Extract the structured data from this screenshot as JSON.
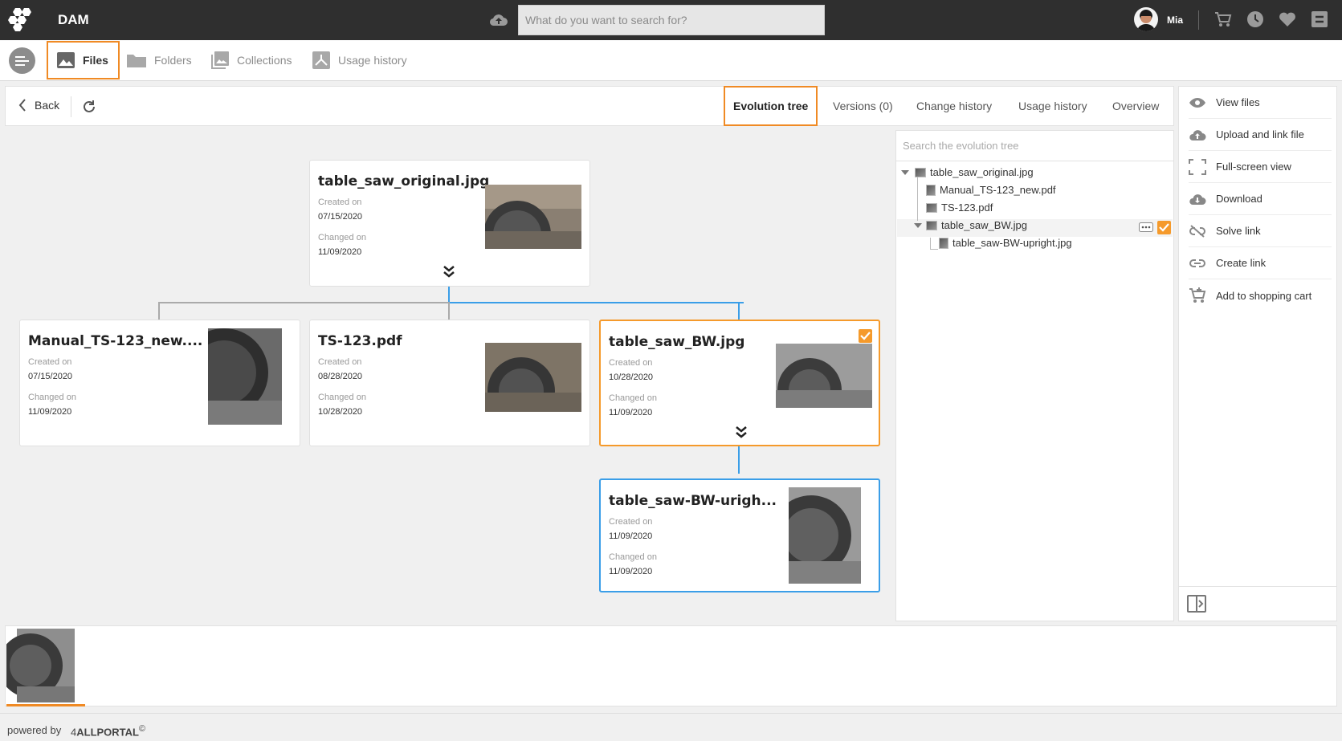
{
  "header": {
    "app_title": "DAM",
    "search_placeholder": "What do you want to search for?",
    "user_name": "Mia",
    "icons": [
      "upload-cloud-icon",
      "cart-icon",
      "clock-icon",
      "heart-icon",
      "exit-icon"
    ]
  },
  "nav": {
    "items": [
      {
        "label": "Files",
        "icon": "image-icon",
        "active": true
      },
      {
        "label": "Folders",
        "icon": "folder-icon",
        "active": false
      },
      {
        "label": "Collections",
        "icon": "collections-icon",
        "active": false
      },
      {
        "label": "Usage history",
        "icon": "usage-history-icon",
        "active": false
      }
    ]
  },
  "toolbar": {
    "back_label": "Back",
    "tabs": [
      {
        "label": "Evolution tree",
        "active": true
      },
      {
        "label": "Versions (0)",
        "active": false
      },
      {
        "label": "Change history",
        "active": false
      },
      {
        "label": "Usage history",
        "active": false
      },
      {
        "label": "Overview",
        "active": false
      }
    ]
  },
  "cards": {
    "created_label": "Created on",
    "changed_label": "Changed on",
    "root": {
      "name": "table_saw_original.jpg",
      "created": "07/15/2020",
      "changed": "11/09/2020"
    },
    "manual": {
      "name": "Manual_TS-123_new....",
      "created": "07/15/2020",
      "changed": "11/09/2020"
    },
    "ts123": {
      "name": "TS-123.pdf",
      "created": "08/28/2020",
      "changed": "10/28/2020"
    },
    "bw": {
      "name": "table_saw_BW.jpg",
      "created": "10/28/2020",
      "changed": "11/09/2020",
      "selected": true
    },
    "upright": {
      "name": "table_saw-BW-urigh...",
      "created": "11/09/2020",
      "changed": "11/09/2020"
    }
  },
  "tree": {
    "search_placeholder": "Search the evolution tree",
    "nodes": [
      {
        "label": "table_saw_original.jpg"
      },
      {
        "label": "Manual_TS-123_new.pdf"
      },
      {
        "label": "TS-123.pdf"
      },
      {
        "label": "table_saw_BW.jpg"
      },
      {
        "label": "table_saw-BW-upright.jpg"
      }
    ]
  },
  "actions": [
    {
      "label": "View files",
      "icon": "eye-icon"
    },
    {
      "label": "Upload and link file",
      "icon": "upload-cloud-icon"
    },
    {
      "label": "Full-screen view",
      "icon": "fullscreen-icon"
    },
    {
      "label": "Download",
      "icon": "download-cloud-icon"
    },
    {
      "label": "Solve link",
      "icon": "unlink-icon"
    },
    {
      "label": "Create link",
      "icon": "link-icon"
    },
    {
      "label": "Add to shopping cart",
      "icon": "add-cart-icon"
    }
  ],
  "footer": {
    "powered_by": "powered by",
    "brand_prefix": "4",
    "brand_name": "ALLPORTAL",
    "copyright": "©"
  },
  "colors": {
    "accent": "#f08a24",
    "link_blue": "#3a9ee8",
    "topbar": "#2f2f2f"
  }
}
